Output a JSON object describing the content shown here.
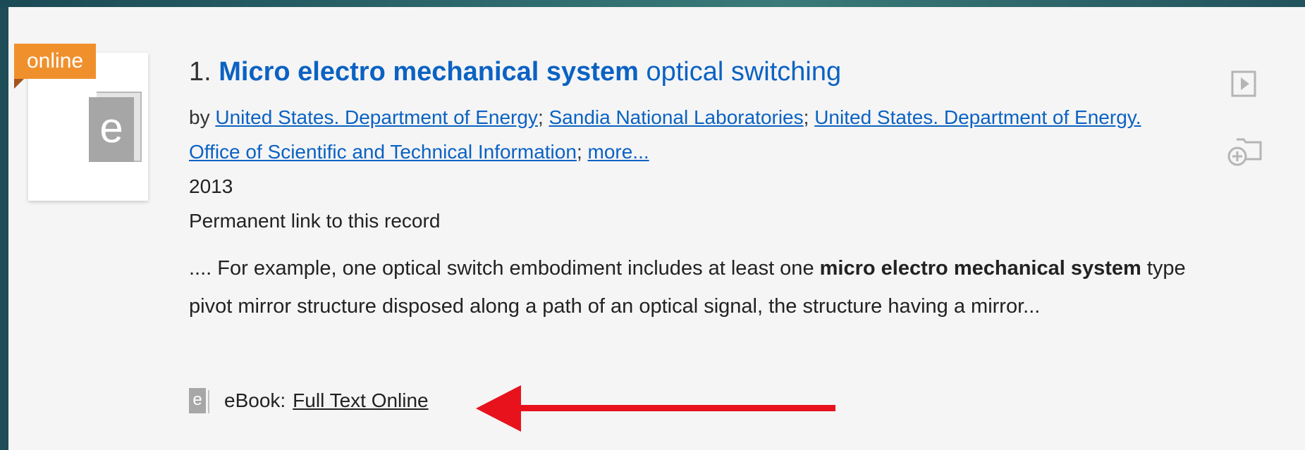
{
  "thumbnail": {
    "tag": "online",
    "icon": "ebook-icon",
    "glyph": "e"
  },
  "result": {
    "number": "1.",
    "title_bold": "Micro electro mechanical system",
    "title_rest": "optical switching",
    "by_label": "by",
    "authors": [
      "United States. Department of Energy",
      "Sandia National Laboratories",
      "United States. Department of Energy. Office of Scientific and Technical Information"
    ],
    "separator": ";",
    "more_label": "more...",
    "year": "2013",
    "permalink": "Permanent link to this record",
    "snippet": {
      "prefix": ".... For example, one optical switch embodiment includes at least one",
      "highlight": "micro electro mechanical system",
      "suffix": "type pivot mirror structure disposed along a path of an optical signal, the structure having a mirror..."
    },
    "format": {
      "icon": "ebook-icon",
      "glyph": "e",
      "label": "eBook:",
      "link": "Full Text Online"
    }
  },
  "side_actions": {
    "preview_icon": "play-preview-icon",
    "add_icon": "add-to-folder-icon"
  },
  "annotation": {
    "arrow_color": "#e8121d"
  },
  "colors": {
    "link": "#0b62c3",
    "tag": "#f0902d",
    "background_frame": "#1e4d57",
    "panel": "#f5f5f5"
  }
}
